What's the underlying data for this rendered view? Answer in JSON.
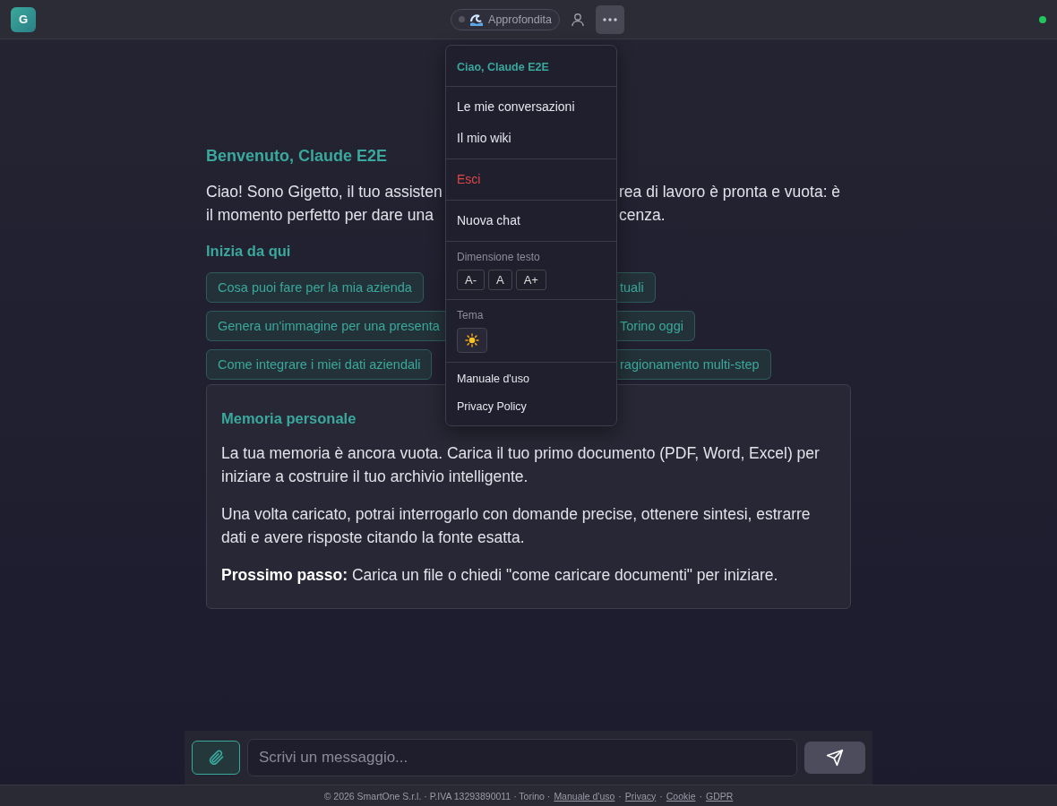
{
  "topbar": {
    "logo": "G",
    "mode": {
      "label": "Approfondita"
    },
    "online": true
  },
  "welcome": {
    "title": "Benvenuto, Claude E2E",
    "lines": [
      {
        "left": "Ciao! Sono Gigetto, il tuo assisten",
        "right": "rea di lavoro è pronta e vuota: è"
      },
      {
        "left": "il momento perfetto per dare una",
        "right": "cenza."
      }
    ]
  },
  "start": {
    "title": "Inizia da qui",
    "rows": [
      [
        {
          "text": "Cosa puoi fare per la mia azienda",
          "kind": "whole"
        },
        {
          "text": "tuali",
          "kind": "tail"
        }
      ],
      [
        {
          "text": "Genera un'immagine per una presenta",
          "kind": "head"
        },
        {
          "text": "Torino oggi",
          "kind": "tail"
        }
      ],
      [
        {
          "text": "Come integrare i miei dati aziendali",
          "kind": "whole"
        },
        {
          "text": "ragionamento multi-step",
          "kind": "tail"
        }
      ]
    ]
  },
  "memory": {
    "title": "Memoria personale",
    "paragraphs": [
      "La tua memoria è ancora vuota. Carica il tuo primo documento (PDF, Word, Excel) per iniziare a costruire il tuo archivio intelligente.",
      "Una volta caricato, potrai interrogarlo con domande precise, ottenere sintesi, estrarre dati e avere risposte citando la fonte esatta.",
      "**Prossimo passo:** Carica un file o chiedi \"come caricare documenti\" per iniziare."
    ]
  },
  "menu": {
    "greeting": "Ciao, Claude E2E",
    "groups": [
      {
        "items": [
          {
            "label": "Le mie conversazioni",
            "kind": "nav"
          },
          {
            "label": "Il mio wiki",
            "kind": "nav"
          }
        ]
      },
      {
        "items": [
          {
            "label": "Esci",
            "kind": "danger"
          }
        ]
      },
      {
        "items": [
          {
            "label": "Nuova chat",
            "kind": "nav"
          }
        ]
      }
    ],
    "text_size": {
      "label": "Dimensione testo",
      "buttons": [
        "A-",
        "A",
        "A+"
      ]
    },
    "theme": {
      "label": "Tema"
    },
    "links": [
      "Manuale d'uso",
      "Privacy Policy"
    ]
  },
  "composer": {
    "placeholder": "Scrivi un messaggio..."
  },
  "footer": [
    {
      "text": "© 2026 SmartOne S.r.l. · P.IVA 13293890011 · Torino ·",
      "kind": "text"
    },
    {
      "text": "Manuale d'uso",
      "kind": "link"
    },
    {
      "text": "·",
      "kind": "text"
    },
    {
      "text": "Privacy",
      "kind": "link"
    },
    {
      "text": "·",
      "kind": "text"
    },
    {
      "text": "Cookie",
      "kind": "link"
    },
    {
      "text": "·",
      "kind": "text"
    },
    {
      "text": "GDPR",
      "kind": "link"
    }
  ]
}
